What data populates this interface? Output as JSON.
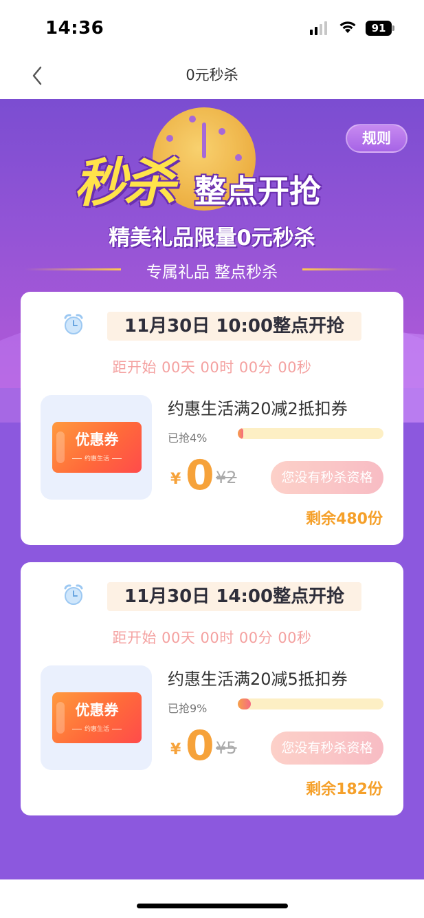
{
  "status_bar": {
    "time": "14:36",
    "battery": "91"
  },
  "nav": {
    "title": "0元秒杀"
  },
  "hero": {
    "title_big": "秒杀",
    "title_rest": "整点开抢",
    "subtitle": "精美礼品限量0元秒杀",
    "tagline": "专属礼品 整点秒杀",
    "rules_label": "规则"
  },
  "items": [
    {
      "time_label": "11月30日 10:00整点开抢",
      "countdown": "距开始 00天 00时 00分 00秒",
      "coupon_title": "优惠券",
      "coupon_sub": "约惠生活",
      "name": "约惠生活满20减2抵扣券",
      "sold_label": "已抢4%",
      "progress": 0.04,
      "currency": "¥",
      "price_now": "0",
      "price_old": "¥2",
      "button_label": "您没有秒杀资格",
      "remaining": "剩余480份"
    },
    {
      "time_label": "11月30日 14:00整点开抢",
      "countdown": "距开始 00天 00时 00分 00秒",
      "coupon_title": "优惠券",
      "coupon_sub": "约惠生活",
      "name": "约惠生活满20减5抵扣券",
      "sold_label": "已抢9%",
      "progress": 0.09,
      "currency": "¥",
      "price_now": "0",
      "price_old": "¥5",
      "button_label": "您没有秒杀资格",
      "remaining": "剩余182份"
    }
  ],
  "colors": {
    "primary_purple": "#8b56d6",
    "price_orange": "#f6a23a",
    "countdown_pink": "#f4a1a0"
  }
}
